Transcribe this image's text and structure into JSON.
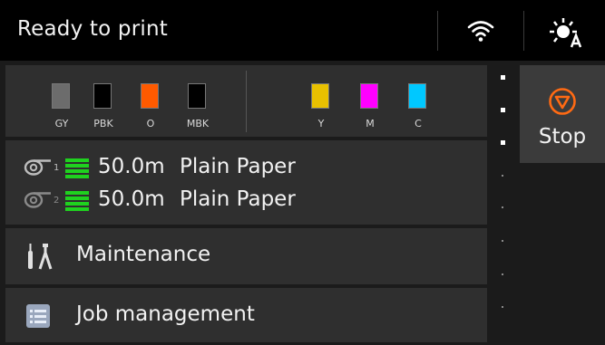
{
  "status": {
    "text": "Ready to print"
  },
  "icons": {
    "wifi": "wifi-icon",
    "eco": "auto-light-icon"
  },
  "inks": [
    {
      "label": "GY",
      "color": "#6c6c6c"
    },
    {
      "label": "PBK",
      "color": "#000000"
    },
    {
      "label": "O",
      "color": "#ff5a00"
    },
    {
      "label": "MBK",
      "color": "#000000"
    },
    {
      "label": "Y",
      "color": "#e8c000"
    },
    {
      "label": "M",
      "color": "#ff00ff"
    },
    {
      "label": "C",
      "color": "#00c8ff"
    }
  ],
  "paper": [
    {
      "roll": "1",
      "amount": "50.0m",
      "type": "Plain Paper"
    },
    {
      "roll": "2",
      "amount": "50.0m",
      "type": "Plain Paper"
    }
  ],
  "menu": {
    "maintenance": "Maintenance",
    "job_management": "Job management"
  },
  "stop": {
    "label": "Stop"
  },
  "colors": {
    "level_green": "#1fd11f",
    "stop_orange": "#ff6a13"
  }
}
